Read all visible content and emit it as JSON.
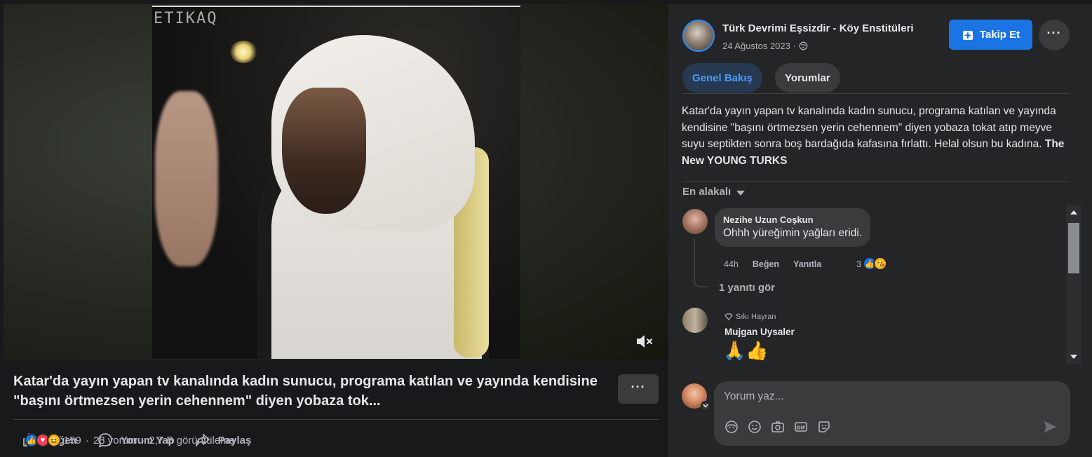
{
  "video": {
    "watermark": "ETIKAQ",
    "title": "Katar'da yayın yapan tv kanalında kadın sunucu, programa katılan ve yayında kendisine \"başını örtmezsen yerin cehennem\" diyen yobaza tok...",
    "actions": {
      "like": "Beğen",
      "comment": "Yorum Yap",
      "share": "Paylaş"
    },
    "stats": {
      "reactions": "159",
      "comments": "28 yorum",
      "views": "2,7 B görüntüleme",
      "sep": "·"
    }
  },
  "page": {
    "name": "Türk Devrimi Eşsizdir - Köy Enstitüleri",
    "date": "24 Ağustos 2023 ·",
    "follow_label": "Takip Et"
  },
  "tabs": {
    "overview": "Genel Bakış",
    "comments": "Yorumlar"
  },
  "description": {
    "text": "Katar'da yayın yapan tv kanalında kadın sunucu, programa katılan ve yayında kendisine \"başını örtmezsen yerin cehennem\" diyen yobaza tokat atıp meyve suyu septikten sonra boş bardağıda kafasına fırlattı. Helal olsun bu kadına.",
    "bold": "The New YOUNG TURKS"
  },
  "comments": {
    "sort_label": "En alakalı",
    "items": [
      {
        "name": "Nezihe Uzun Coşkun",
        "text": "Ohhh yüreğimin yağları eridi.",
        "time": "44h",
        "like": "Beğen",
        "reply": "Yanıtla",
        "reaction_count": "3",
        "see_replies": "1 yanıtı gör"
      },
      {
        "badge": "Sıkı Hayran",
        "name": "Mujgan Uysaler",
        "text": "🙏👍"
      }
    ],
    "input_placeholder": "Yorum yaz..."
  },
  "colors": {
    "accent": "#1b74e4",
    "panel": "#242526",
    "background": "#18191a"
  }
}
